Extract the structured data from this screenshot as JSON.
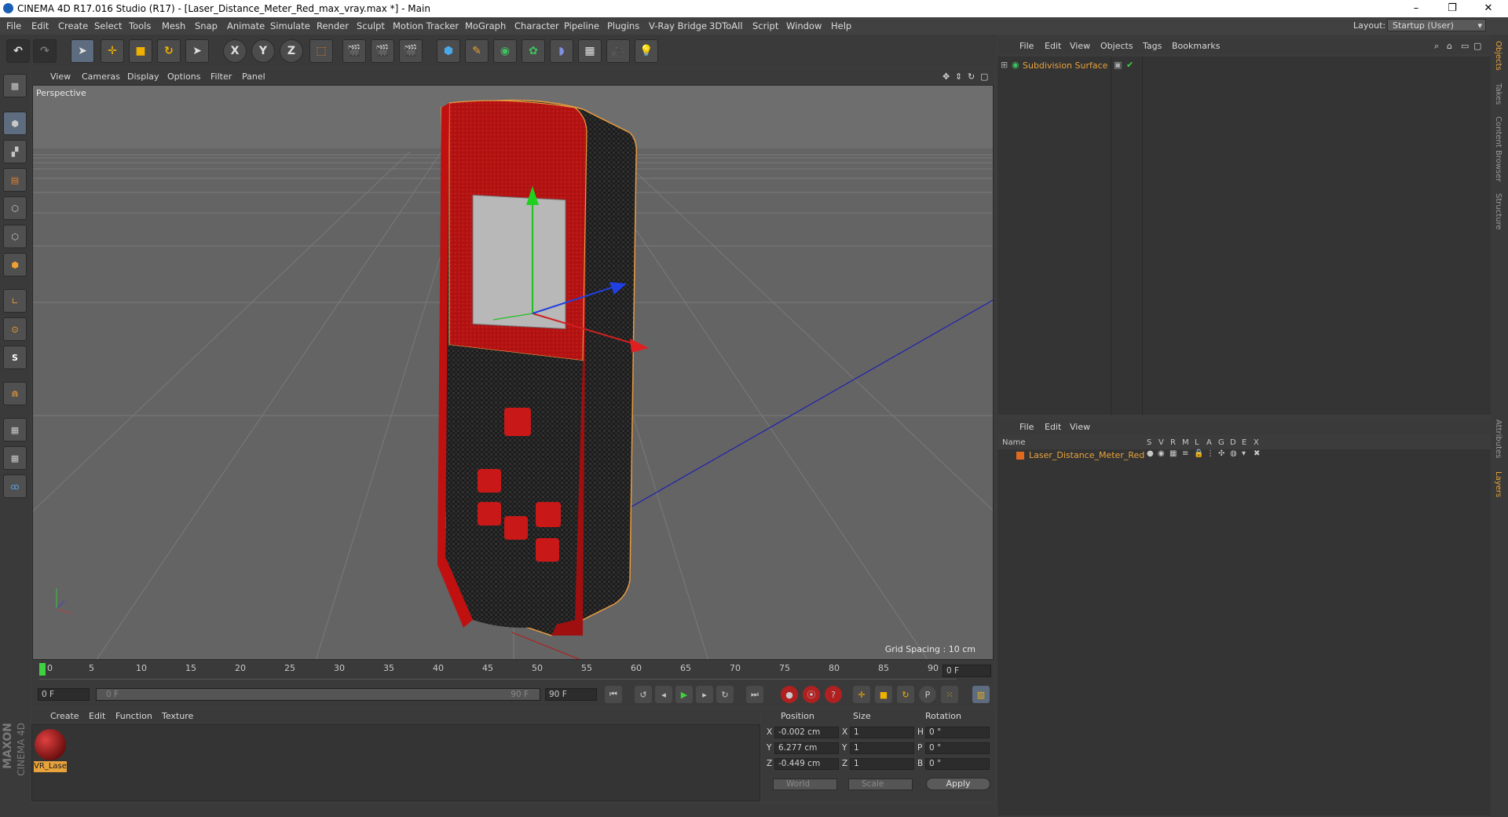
{
  "window": {
    "title": "CINEMA 4D R17.016 Studio (R17) - [Laser_Distance_Meter_Red_max_vray.max *] - Main",
    "minimize": "–",
    "restore": "❐",
    "close": "✕"
  },
  "menu": [
    "File",
    "Edit",
    "Create",
    "Select",
    "Tools",
    "Mesh",
    "Snap",
    "Animate",
    "Simulate",
    "Render",
    "Sculpt",
    "Motion Tracker",
    "MoGraph",
    "Character",
    "Pipeline",
    "Plugins",
    "V-Ray Bridge",
    "3DToAll",
    "Script",
    "Window",
    "Help"
  ],
  "layout": {
    "label": "Layout:",
    "value": "Startup (User)"
  },
  "toolbar": {
    "x_label": "X",
    "y_label": "Y",
    "z_label": "Z"
  },
  "viewport": {
    "menu": [
      "View",
      "Cameras",
      "Display",
      "Options",
      "Filter",
      "Panel"
    ],
    "label": "Perspective",
    "grid_spacing": "Grid Spacing : 10 cm"
  },
  "timeline": {
    "ticks": [
      "0",
      "5",
      "10",
      "15",
      "20",
      "25",
      "30",
      "35",
      "40",
      "45",
      "50",
      "55",
      "60",
      "65",
      "70",
      "75",
      "80",
      "85",
      "90"
    ],
    "end_frame": "0 F",
    "current_frame": "0 F",
    "range_start": "0 F",
    "range_end": "90 F",
    "max_frame": "90 F"
  },
  "material_manager": {
    "menu": [
      "Create",
      "Edit",
      "Function",
      "Texture"
    ],
    "materials": [
      {
        "name": "VR_Lase"
      }
    ]
  },
  "coordinates": {
    "headers": {
      "position": "Position",
      "size": "Size",
      "rotation": "Rotation"
    },
    "rows": [
      {
        "axis": "X",
        "pos": "-0.002 cm",
        "size_axis": "X",
        "size": "1",
        "rot_axis": "H",
        "rot": "0 °"
      },
      {
        "axis": "Y",
        "pos": "6.277 cm",
        "size_axis": "Y",
        "size": "1",
        "rot_axis": "P",
        "rot": "0 °"
      },
      {
        "axis": "Z",
        "pos": "-0.449 cm",
        "size_axis": "Z",
        "size": "1",
        "rot_axis": "B",
        "rot": "0 °"
      }
    ],
    "mode": "World",
    "size_mode": "Scale",
    "apply": "Apply"
  },
  "object_manager": {
    "menu": [
      "File",
      "Edit",
      "View",
      "Objects",
      "Tags",
      "Bookmarks"
    ],
    "objects": [
      {
        "name": "Subdivision Surface"
      }
    ]
  },
  "layer_manager": {
    "menu": [
      "File",
      "Edit",
      "View"
    ],
    "name_header": "Name",
    "columns": [
      "S",
      "V",
      "R",
      "M",
      "L",
      "A",
      "G",
      "D",
      "E",
      "X"
    ],
    "layers": [
      {
        "name": "Laser_Distance_Meter_Red",
        "color": "#e06a1c"
      }
    ]
  },
  "right_tabs": [
    "Objects",
    "Takes",
    "Content Browser",
    "Structure",
    "Attributes",
    "Layers"
  ],
  "branding": {
    "line1": "MAXON",
    "line2": "CINEMA 4D"
  },
  "colors": {
    "accent_orange": "#e8a33c",
    "layer_orange": "#e06a1c",
    "play_green": "#3fd13f"
  }
}
